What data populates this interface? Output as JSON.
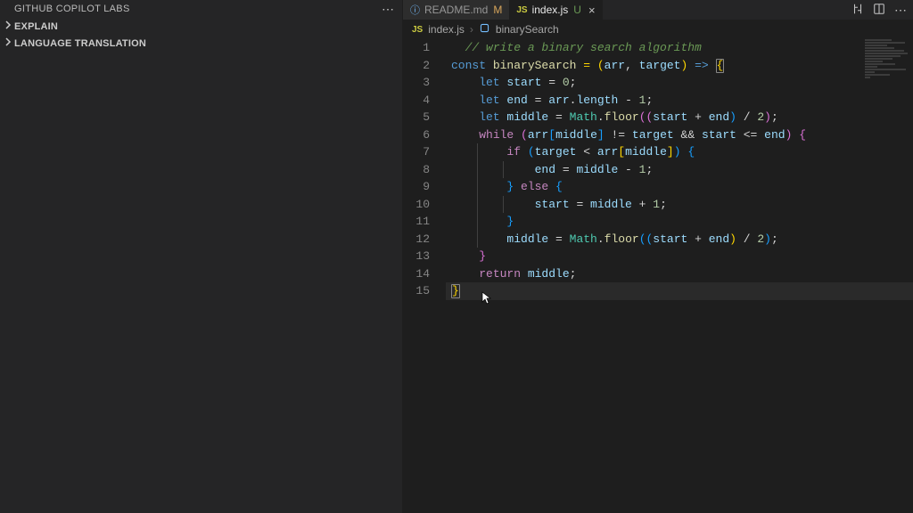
{
  "sidebar": {
    "title": "GITHUB COPILOT LABS",
    "sections": [
      {
        "label": "EXPLAIN"
      },
      {
        "label": "LANGUAGE TRANSLATION"
      }
    ]
  },
  "tabs": [
    {
      "icon": "info",
      "label": "README.md",
      "modifier": "M",
      "active": false
    },
    {
      "icon": "js",
      "label": "index.js",
      "modifier": "U",
      "active": true
    }
  ],
  "breadcrumbs": {
    "fileIcon": "JS",
    "file": "index.js",
    "symbol": "binarySearch"
  },
  "code": {
    "lines": [
      {
        "n": 1,
        "tokens": [
          [
            "  ",
            "op"
          ],
          [
            "// write a binary search algorithm",
            "cm"
          ]
        ]
      },
      {
        "n": 2,
        "tokens": [
          [
            "const ",
            "k"
          ],
          [
            "binarySearch",
            "fn"
          ],
          [
            " = (",
            "pn-y"
          ],
          [
            "arr",
            "v"
          ],
          [
            ", ",
            "op"
          ],
          [
            "target",
            "v"
          ],
          [
            ")",
            "pn-y"
          ],
          [
            " ",
            "op"
          ],
          [
            "=>",
            "k"
          ],
          [
            " ",
            "op"
          ],
          [
            "{",
            "pn-y match-open"
          ]
        ]
      },
      {
        "n": 3,
        "tokens": [
          [
            "    let ",
            "k"
          ],
          [
            "start",
            "v"
          ],
          [
            " = ",
            "op"
          ],
          [
            "0",
            "n"
          ],
          [
            ";",
            "op"
          ]
        ]
      },
      {
        "n": 4,
        "tokens": [
          [
            "    let ",
            "k"
          ],
          [
            "end",
            "v"
          ],
          [
            " = ",
            "op"
          ],
          [
            "arr",
            "v"
          ],
          [
            ".",
            "op"
          ],
          [
            "length",
            "v"
          ],
          [
            " - ",
            "op"
          ],
          [
            "1",
            "n"
          ],
          [
            ";",
            "op"
          ]
        ]
      },
      {
        "n": 5,
        "tokens": [
          [
            "    let ",
            "k"
          ],
          [
            "middle",
            "v"
          ],
          [
            " = ",
            "op"
          ],
          [
            "Math",
            "obj"
          ],
          [
            ".",
            "op"
          ],
          [
            "floor",
            "fn"
          ],
          [
            "((",
            "pn-p"
          ],
          [
            "start",
            "v"
          ],
          [
            " + ",
            "op"
          ],
          [
            "end",
            "v"
          ],
          [
            ")",
            "pn-b"
          ],
          [
            " / ",
            "op"
          ],
          [
            "2",
            "n"
          ],
          [
            ")",
            "pn-p"
          ],
          [
            ";",
            "op"
          ]
        ]
      },
      {
        "n": 6,
        "tokens": [
          [
            "    ",
            "op"
          ],
          [
            "while ",
            "k2"
          ],
          [
            "(",
            "pn-p"
          ],
          [
            "arr",
            "v"
          ],
          [
            "[",
            "pn-b"
          ],
          [
            "middle",
            "v"
          ],
          [
            "]",
            "pn-b"
          ],
          [
            " != ",
            "op"
          ],
          [
            "target",
            "v"
          ],
          [
            " && ",
            "op"
          ],
          [
            "start",
            "v"
          ],
          [
            " <= ",
            "op"
          ],
          [
            "end",
            "v"
          ],
          [
            ")",
            "pn-p"
          ],
          [
            " {",
            "pn-p"
          ]
        ]
      },
      {
        "n": 7,
        "tokens": [
          [
            "        ",
            "op"
          ],
          [
            "if ",
            "k2"
          ],
          [
            "(",
            "pn-b"
          ],
          [
            "target",
            "v"
          ],
          [
            " < ",
            "op"
          ],
          [
            "arr",
            "v"
          ],
          [
            "[",
            "pn-y"
          ],
          [
            "middle",
            "v"
          ],
          [
            "]",
            "pn-y"
          ],
          [
            ")",
            "pn-b"
          ],
          [
            " {",
            "pn-b"
          ]
        ]
      },
      {
        "n": 8,
        "tokens": [
          [
            "            ",
            "op"
          ],
          [
            "end",
            "v"
          ],
          [
            " = ",
            "op"
          ],
          [
            "middle",
            "v"
          ],
          [
            " - ",
            "op"
          ],
          [
            "1",
            "n"
          ],
          [
            ";",
            "op"
          ]
        ]
      },
      {
        "n": 9,
        "tokens": [
          [
            "        } ",
            "pn-b"
          ],
          [
            "else",
            "k2"
          ],
          [
            " {",
            "pn-b"
          ]
        ]
      },
      {
        "n": 10,
        "tokens": [
          [
            "            ",
            "op"
          ],
          [
            "start",
            "v"
          ],
          [
            " = ",
            "op"
          ],
          [
            "middle",
            "v"
          ],
          [
            " + ",
            "op"
          ],
          [
            "1",
            "n"
          ],
          [
            ";",
            "op"
          ]
        ]
      },
      {
        "n": 11,
        "tokens": [
          [
            "        }",
            "pn-b"
          ]
        ]
      },
      {
        "n": 12,
        "tokens": [
          [
            "        ",
            "op"
          ],
          [
            "middle",
            "v"
          ],
          [
            " = ",
            "op"
          ],
          [
            "Math",
            "obj"
          ],
          [
            ".",
            "op"
          ],
          [
            "floor",
            "fn"
          ],
          [
            "((",
            "pn-b"
          ],
          [
            "start",
            "v"
          ],
          [
            " + ",
            "op"
          ],
          [
            "end",
            "v"
          ],
          [
            ")",
            "pn-y"
          ],
          [
            " / ",
            "op"
          ],
          [
            "2",
            "n"
          ],
          [
            ")",
            "pn-b"
          ],
          [
            ";",
            "op"
          ]
        ]
      },
      {
        "n": 13,
        "tokens": [
          [
            "    }",
            "pn-p"
          ]
        ]
      },
      {
        "n": 14,
        "tokens": [
          [
            "    ",
            "op"
          ],
          [
            "return ",
            "k2"
          ],
          [
            "middle",
            "v"
          ],
          [
            ";",
            "op"
          ]
        ]
      },
      {
        "n": 15,
        "tokens": [
          [
            "}",
            "pn-y match-close"
          ]
        ],
        "highlight": true
      }
    ]
  }
}
